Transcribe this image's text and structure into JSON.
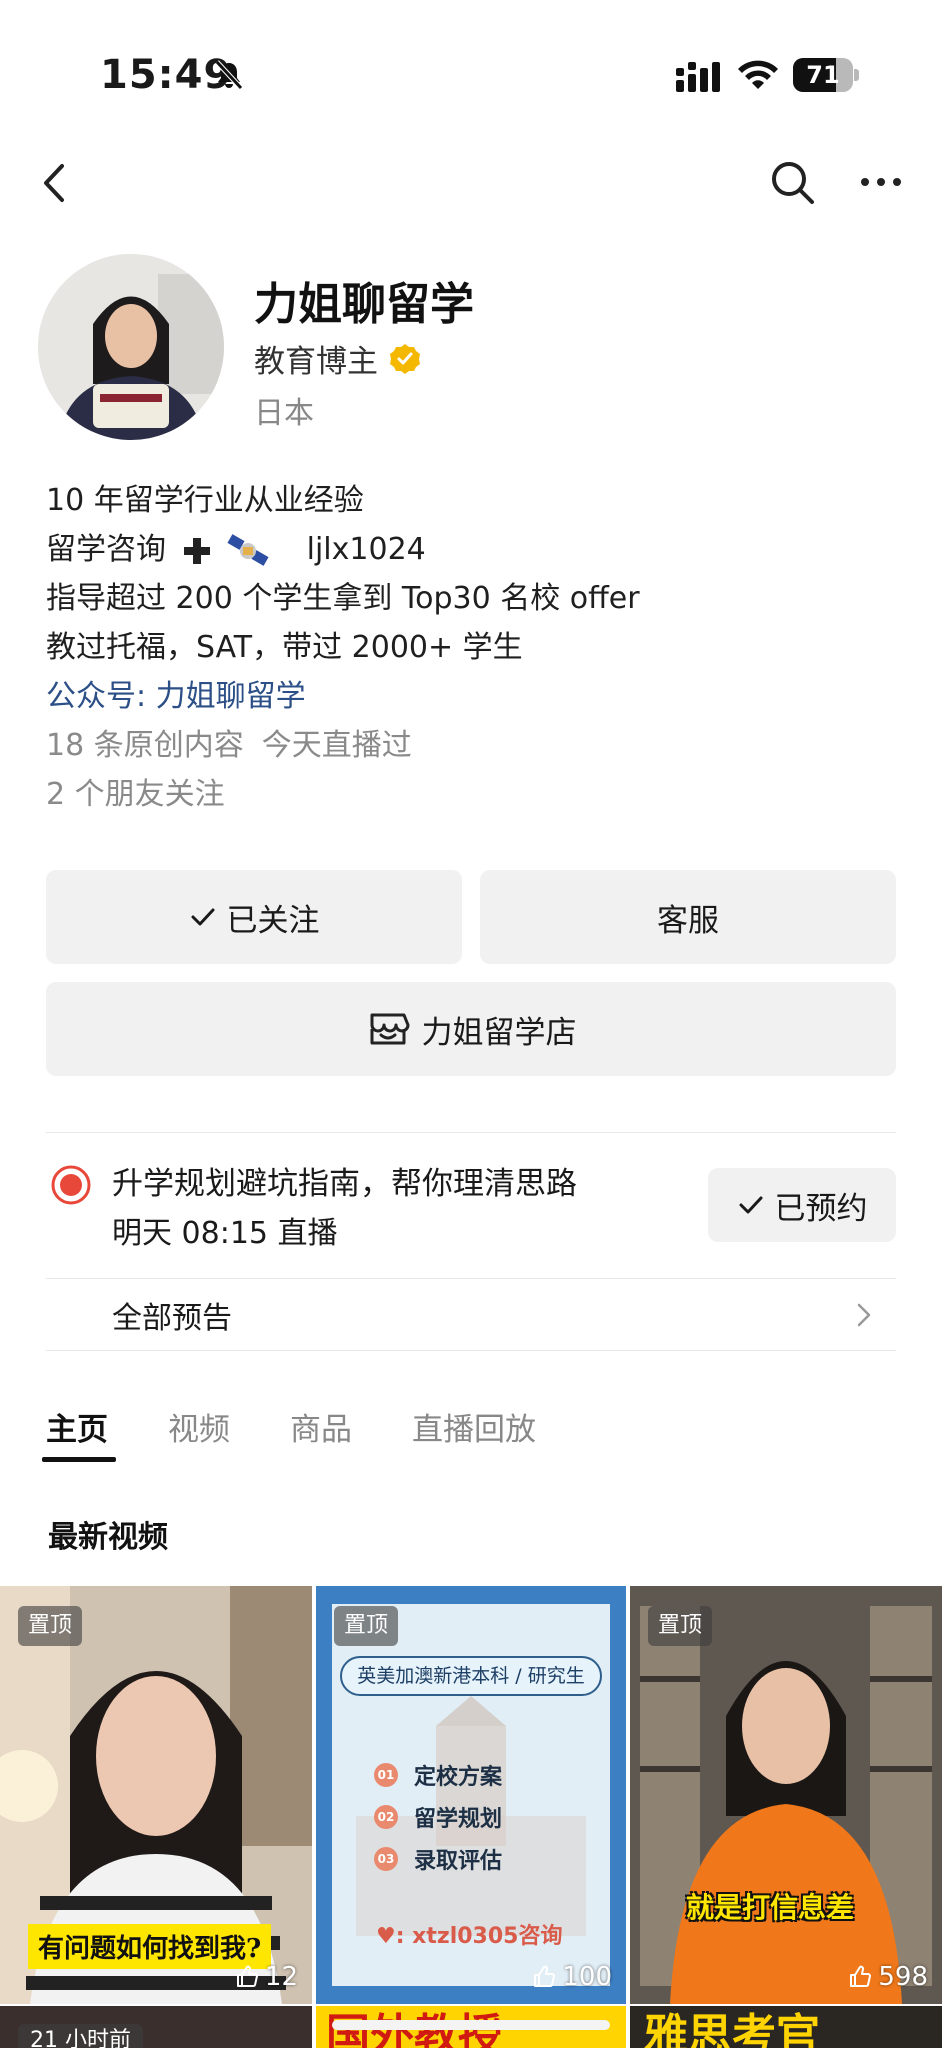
{
  "status_bar": {
    "time": "15:49",
    "battery": "71",
    "battery_level": 0.71,
    "icons": [
      "bell-slash-icon",
      "signal-icon",
      "wifi-icon",
      "battery-icon"
    ]
  },
  "nav": {
    "icons": [
      "back-arrow-icon",
      "search-icon",
      "more-icon"
    ]
  },
  "profile": {
    "name": "力姐聊留学",
    "role": "教育博主",
    "location": "日本",
    "verified_color": "#f5b800"
  },
  "bio": {
    "line1": "10 年留学行业从业经验",
    "line2_prefix": "留学咨询",
    "line2_id": "ljlx1024",
    "line3": "指导超过 200 个学生拿到 Top30 名校 offer",
    "line4": "教过托福，SAT，带过 2000+ 学生",
    "official_account": "公众号: 力姐聊留学",
    "original_content": "18 条原创内容",
    "live_status": "今天直播过",
    "friends_follow": "2 个朋友关注"
  },
  "actions": {
    "follow_label": "已关注",
    "service_label": "客服",
    "shop_label": "力姐留学店"
  },
  "live": {
    "title": "升学规划避坑指南，帮你理清思路",
    "time": "明天 08:15 直播",
    "reserved_label": "已预约",
    "all_previews": "全部预告",
    "accent_color": "#e8483a"
  },
  "tabs": [
    {
      "label": "主页",
      "active": true
    },
    {
      "label": "视频",
      "active": false
    },
    {
      "label": "商品",
      "active": false
    },
    {
      "label": "直播回放",
      "active": false
    }
  ],
  "section_title": "最新视频",
  "videos": [
    {
      "pin": "置顶",
      "caption": "有问题如何找到我?",
      "likes": "12"
    },
    {
      "pin": "置顶",
      "heading": "英美加澳新港本科 / 研究生",
      "items": [
        "定校方案",
        "留学规划",
        "录取评估"
      ],
      "item_numbers": [
        "01",
        "02",
        "03"
      ],
      "contact": "♥: xtzl0305咨询",
      "likes": "100"
    },
    {
      "pin": "置顶",
      "caption": "就是打信息差",
      "likes": "598"
    }
  ],
  "bottom_row": {
    "time_ago": "21 小时前",
    "text_2": "国外教授",
    "text_3": "雅思考官"
  }
}
